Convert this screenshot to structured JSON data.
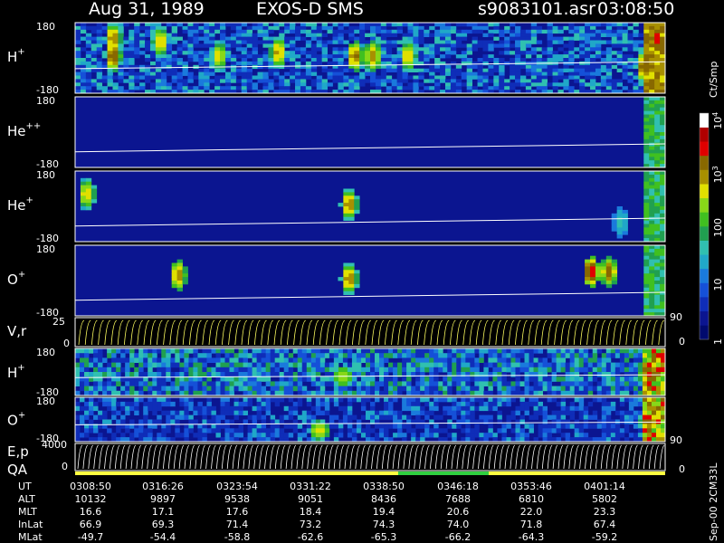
{
  "header": {
    "date": "Aug 31, 1989",
    "instrument": "EXOS-D SMS",
    "file": "s9083101.asr",
    "time": "03:08:50"
  },
  "colorbar": {
    "unit": "Ct/Smp",
    "ticks": [
      {
        "label": "1",
        "value": 1
      },
      {
        "label": "10",
        "value": 10
      },
      {
        "label": "100",
        "value": 100
      },
      {
        "label": "10",
        "sup": "3",
        "value": 1000
      },
      {
        "label": "10",
        "sup": "4",
        "value": 10000
      }
    ],
    "colors": [
      "#000a6e",
      "#0b1590",
      "#0f2db8",
      "#1550d8",
      "#1a7adc",
      "#20a8c8",
      "#30c0b0",
      "#20a050",
      "#40c020",
      "#88d818",
      "#e0e000",
      "#a89000",
      "#886800",
      "#e00000",
      "#b00000",
      "#ffffff"
    ]
  },
  "chart_data": {
    "type": "heatmap",
    "x_ticks": [
      "0308:50",
      "0316:26",
      "0323:54",
      "0331:22",
      "0338:50",
      "0346:18",
      "0353:46",
      "0401:14"
    ],
    "panels": [
      {
        "id": "h-plus",
        "label": "H",
        "sup": "+",
        "ytop": "180",
        "ybot": "-180",
        "y_range": [
          -180,
          180
        ],
        "base": 1.1,
        "background": 0.55,
        "hotspots": [
          [
            0.06,
            0.2,
            2.6
          ],
          [
            0.06,
            0.45,
            2.8
          ],
          [
            0.14,
            0.25,
            2.4
          ],
          [
            0.24,
            0.45,
            2.3
          ],
          [
            0.34,
            0.4,
            2.5
          ],
          [
            0.47,
            0.45,
            2.7
          ],
          [
            0.5,
            0.45,
            2.6
          ],
          [
            0.56,
            0.45,
            2.4
          ],
          [
            0.96,
            0.6,
            2.8
          ],
          [
            0.98,
            0.2,
            3.0
          ]
        ],
        "line": [
          -55,
          -20
        ]
      },
      {
        "id": "he-plusplus",
        "label": "He",
        "sup": "++",
        "ytop": "180",
        "ybot": "-180",
        "y_range": [
          -180,
          180
        ],
        "base": 0.05,
        "background": 0.05,
        "hotspots": [
          [
            0.97,
            0.5,
            1.6
          ],
          [
            0.98,
            0.8,
            1.7
          ]
        ],
        "line": [
          -100,
          -60
        ]
      },
      {
        "id": "he-plus",
        "label": "He",
        "sup": "+",
        "ytop": "180",
        "ybot": "-180",
        "y_range": [
          -180,
          180
        ],
        "base": 0.1,
        "background": 0.1,
        "hotspots": [
          [
            0.015,
            0.3,
            2.4
          ],
          [
            0.46,
            0.45,
            2.6
          ],
          [
            0.92,
            0.7,
            1.4
          ],
          [
            0.97,
            0.5,
            1.7
          ]
        ],
        "line": [
          -100,
          -60
        ]
      },
      {
        "id": "o-plus",
        "label": "O",
        "sup": "+",
        "ytop": "180",
        "ybot": "-180",
        "y_range": [
          -180,
          180
        ],
        "base": 0.1,
        "background": 0.1,
        "hotspots": [
          [
            0.17,
            0.4,
            2.6
          ],
          [
            0.46,
            0.45,
            2.6
          ],
          [
            0.87,
            0.35,
            3.0
          ],
          [
            0.9,
            0.35,
            2.7
          ],
          [
            0.97,
            0.5,
            1.8
          ]
        ],
        "line": [
          -100,
          -60
        ]
      }
    ],
    "velocity_panel": {
      "label": "V,r",
      "ytop": "25",
      "ybot": "0",
      "right_top": "90",
      "right_bot": "0"
    },
    "lower_panels": [
      {
        "id": "h-plus-2",
        "label": "H",
        "sup": "+",
        "ytop": "180",
        "ybot": "-180",
        "base": 1.4,
        "background": 0.7,
        "hotspots": [
          [
            0.45,
            0.55,
            2.2
          ],
          [
            0.97,
            0.5,
            2.9
          ]
        ],
        "line": [
          -40,
          -20
        ]
      },
      {
        "id": "o-plus-2",
        "label": "O",
        "sup": "+",
        "ytop": "180",
        "ybot": "-180",
        "base": 1.0,
        "background": 0.5,
        "hotspots": [
          [
            0.41,
            0.7,
            2.3
          ],
          [
            0.97,
            0.5,
            2.7
          ]
        ],
        "line": [
          -60,
          -40
        ]
      }
    ],
    "energy_panel": {
      "label1": "E,p",
      "label2": "QA",
      "ytop": "4000",
      "ybot": "0",
      "right_top": "90",
      "right_bot": "0"
    },
    "table": {
      "rows": [
        {
          "name": "UT",
          "values": [
            "0308:50",
            "0316:26",
            "0323:54",
            "0331:22",
            "0338:50",
            "0346:18",
            "0353:46",
            "0401:14"
          ]
        },
        {
          "name": "ALT",
          "values": [
            "10132",
            "9897",
            "9538",
            "9051",
            "8436",
            "7688",
            "6810",
            "5802"
          ]
        },
        {
          "name": "MLT",
          "values": [
            "16.6",
            "17.1",
            "17.6",
            "18.4",
            "19.4",
            "20.6",
            "22.0",
            "23.3"
          ]
        },
        {
          "name": "InLat",
          "values": [
            "66.9",
            "69.3",
            "71.4",
            "73.2",
            "74.3",
            "74.0",
            "71.8",
            "67.4"
          ]
        },
        {
          "name": "MLat",
          "values": [
            "-49.7",
            "-54.4",
            "-58.8",
            "-62.6",
            "-65.3",
            "-66.2",
            "-64.3",
            "-59.2"
          ]
        }
      ]
    },
    "side_note": "Sep-00 2CM33L"
  }
}
